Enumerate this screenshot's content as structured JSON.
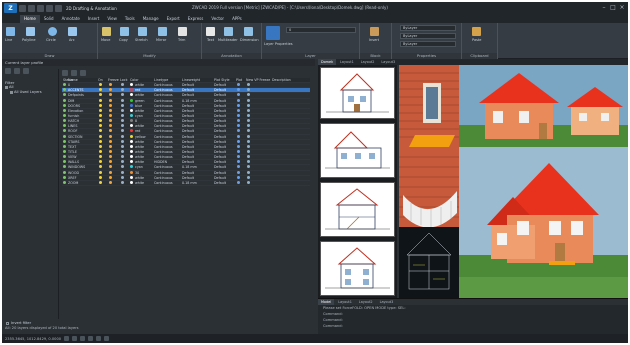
{
  "title_bar": {
    "workspace": "2D Drafting & Annotation",
    "document_title": "ZWCAD 2019 Full version [Metric] [ZWCAD/PE] - [C:\\Users\\Ilona\\Desktop\\Domek.dwg] (Read-only)"
  },
  "tabs": [
    "Home",
    "Solid",
    "Annotate",
    "Insert",
    "View",
    "Tools",
    "Manage",
    "Export",
    "Express",
    "Vector",
    "APPs"
  ],
  "ribbon": {
    "panels": [
      {
        "title": "Draw",
        "buttons": [
          "Line",
          "Polyline",
          "Circle",
          "Arc"
        ]
      },
      {
        "title": "Modify",
        "buttons": [
          "Move",
          "Copy",
          "Stretch",
          "Mirror",
          "Trim"
        ]
      },
      {
        "title": "Annotation",
        "buttons": [
          "Text",
          "Multileader",
          "Dimension"
        ]
      },
      {
        "title": "Layer",
        "buttons": [
          "Layer Properties"
        ]
      },
      {
        "title": "Block",
        "buttons": [
          "Insert"
        ]
      },
      {
        "title": "Properties",
        "combos": [
          "ByLayer",
          "ByLayer",
          "ByLayer"
        ]
      },
      {
        "title": "Clipboard",
        "buttons": [
          "Paste"
        ]
      }
    ],
    "layer_combo": "0",
    "layer_props_label": "Layer Properties"
  },
  "left_panel": {
    "header": "Current layer profile",
    "filter_label": "Filter",
    "tree": [
      "All",
      "All Used Layers"
    ],
    "invert_label": "Invert filter",
    "status": "All: 20 layers displayed of 20 total layers"
  },
  "layer_table": {
    "columns": [
      "Status",
      "Name",
      "On",
      "Freeze",
      "Lock",
      "Color",
      "Linetype",
      "Lineweight",
      "Plot Style",
      "Plot",
      "New VP Freeze",
      "Description"
    ],
    "rows": [
      {
        "name": "0",
        "color": "white",
        "color_hex": "#ffffff",
        "linetype": "Continuous",
        "lineweight": "Default",
        "plotstyle": "Default",
        "selected": false
      },
      {
        "name": "ACCENTS",
        "color": "red",
        "color_hex": "#e83a3a",
        "linetype": "Continuous",
        "lineweight": "Default",
        "plotstyle": "Default",
        "selected": true
      },
      {
        "name": "Defpoints",
        "color": "white",
        "color_hex": "#ffffff",
        "linetype": "Continuous",
        "lineweight": "Default",
        "plotstyle": "Default",
        "selected": false
      },
      {
        "name": "DIM",
        "color": "green",
        "color_hex": "#3cc43c",
        "linetype": "Continuous",
        "lineweight": "0.18 mm",
        "plotstyle": "Default",
        "selected": false
      },
      {
        "name": "DOORS",
        "color": "blue",
        "color_hex": "#3a7ae8",
        "linetype": "Continuous",
        "lineweight": "Default",
        "plotstyle": "Default",
        "selected": false
      },
      {
        "name": "Elevation",
        "color": "white",
        "color_hex": "#ffffff",
        "linetype": "Continuous",
        "lineweight": "Default",
        "plotstyle": "Default",
        "selected": false
      },
      {
        "name": "furnish",
        "color": "cyan",
        "color_hex": "#3ad0d8",
        "linetype": "Continuous",
        "lineweight": "Default",
        "plotstyle": "Default",
        "selected": false
      },
      {
        "name": "HATCH",
        "color": "8",
        "color_hex": "#808080",
        "linetype": "Continuous",
        "lineweight": "Default",
        "plotstyle": "Default",
        "selected": false
      },
      {
        "name": "LINES",
        "color": "white",
        "color_hex": "#ffffff",
        "linetype": "Continuous",
        "lineweight": "Default",
        "plotstyle": "Default",
        "selected": false
      },
      {
        "name": "ROOF",
        "color": "red",
        "color_hex": "#e83a3a",
        "linetype": "Continuous",
        "lineweight": "Default",
        "plotstyle": "Default",
        "selected": false
      },
      {
        "name": "SECTION",
        "color": "yellow",
        "color_hex": "#e8d83a",
        "linetype": "Continuous",
        "lineweight": "Default",
        "plotstyle": "Default",
        "selected": false
      },
      {
        "name": "STAIRS",
        "color": "white",
        "color_hex": "#ffffff",
        "linetype": "Continuous",
        "lineweight": "Default",
        "plotstyle": "Default",
        "selected": false
      },
      {
        "name": "TEXT",
        "color": "white",
        "color_hex": "#ffffff",
        "linetype": "Continuous",
        "lineweight": "Default",
        "plotstyle": "Default",
        "selected": false
      },
      {
        "name": "TITLE",
        "color": "white",
        "color_hex": "#ffffff",
        "linetype": "Continuous",
        "lineweight": "Default",
        "plotstyle": "Default",
        "selected": false
      },
      {
        "name": "VIEW",
        "color": "white",
        "color_hex": "#ffffff",
        "linetype": "Continuous",
        "lineweight": "Default",
        "plotstyle": "Default",
        "selected": false
      },
      {
        "name": "WALLS",
        "color": "white",
        "color_hex": "#ffffff",
        "linetype": "HIDDEN",
        "lineweight": "Default",
        "plotstyle": "Default",
        "selected": false
      },
      {
        "name": "WINDOWS",
        "color": "cyan",
        "color_hex": "#3ad0d8",
        "linetype": "Continuous",
        "lineweight": "0.18 mm",
        "plotstyle": "Default",
        "selected": false
      },
      {
        "name": "WOOD",
        "color": "30",
        "color_hex": "#e8903a",
        "linetype": "Continuous",
        "lineweight": "Default",
        "plotstyle": "Default",
        "selected": false
      },
      {
        "name": "XREF",
        "color": "white",
        "color_hex": "#ffffff",
        "linetype": "Continuous",
        "lineweight": "Default",
        "plotstyle": "Default",
        "selected": false
      },
      {
        "name": "ZOOM",
        "color": "white",
        "color_hex": "#ffffff",
        "linetype": "Continuous",
        "lineweight": "0.18 mm",
        "plotstyle": "Default",
        "selected": false
      }
    ]
  },
  "view_tabs": [
    "Domek",
    "Layout1",
    "Layout2",
    "Layout3"
  ],
  "layout_tabs": [
    "Model",
    "Layout1",
    "Layout2",
    "Layout3"
  ],
  "command_lines": [
    "Please set ForceFOLD: OPEN MODE type: SEL:",
    "Command:",
    "Command:",
    "Command:"
  ],
  "status_bar": {
    "coordinates": "2355.3645, 1012.8429, 0.0000"
  }
}
